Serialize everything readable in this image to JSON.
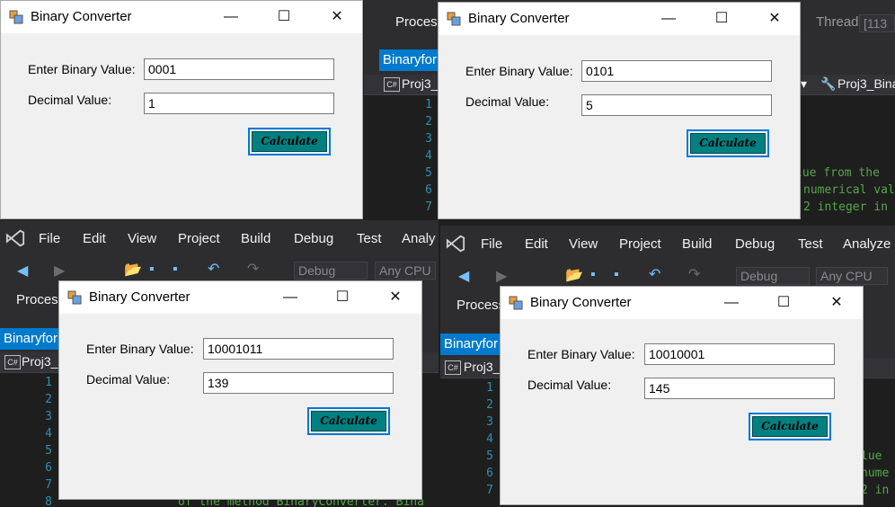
{
  "vs": {
    "menu": [
      "File",
      "Edit",
      "View",
      "Project",
      "Build",
      "Debug",
      "Test",
      "Analyze"
    ],
    "menu_truncated_analyze": "Analy",
    "process_label": "Process",
    "thread_label": "Thread:",
    "thread_value": "[113",
    "debug_combo": "Debug",
    "cpu_combo": "Any CPU",
    "doc_tab": "Binaryfor",
    "project_nav": "Proj3_",
    "project_nav_right": "Proj3_Bina",
    "line_numbers": [
      "1",
      "2",
      "3",
      "4",
      "5",
      "6",
      "7",
      "8"
    ],
    "code_right_top": [
      "lue from the",
      "numerical val",
      "2 integer in"
    ],
    "code_right_bottom": [
      "lue",
      "nume",
      "2 in"
    ],
    "code_bottom": "of the method BinaryConverter. Bina",
    "code_fragments_l": [
      "l",
      "n",
      "2"
    ]
  },
  "dialogs": [
    {
      "title": "Binary Converter",
      "binary_label": "Enter Binary Value:",
      "binary_value": "0001",
      "decimal_label": "Decimal Value:",
      "decimal_value": "1",
      "button": "Calculate"
    },
    {
      "title": "Binary Converter",
      "binary_label": "Enter Binary Value:",
      "binary_value": "0101",
      "decimal_label": "Decimal Value:",
      "decimal_value": "5",
      "button": "Calculate"
    },
    {
      "title": "Binary Converter",
      "binary_label": "Enter Binary Value:",
      "binary_value": "10001011",
      "decimal_label": "Decimal Value:",
      "decimal_value": "139",
      "button": "Calculate"
    },
    {
      "title": "Binary Converter",
      "binary_label": "Enter Binary Value:",
      "binary_value": "10010001",
      "decimal_label": "Decimal Value:",
      "decimal_value": "145",
      "button": "Calculate"
    }
  ],
  "window_controls": {
    "minimize": "—",
    "maximize": "☐",
    "close": "✕"
  },
  "colors": {
    "accent": "#007acc",
    "button_fill": "#008080",
    "button_focus": "#0078d7"
  }
}
